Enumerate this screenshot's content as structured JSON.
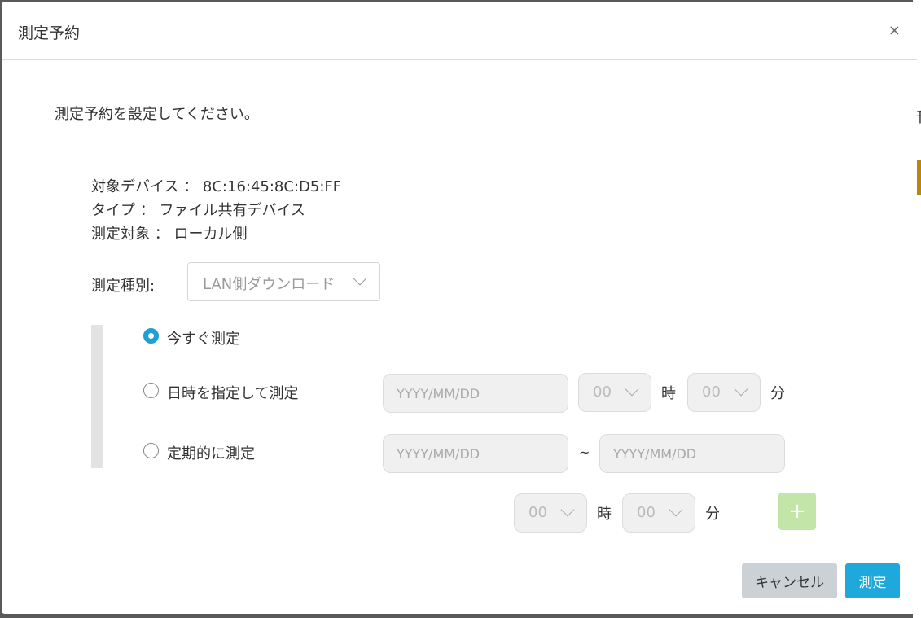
{
  "dialog": {
    "title": "測定予約",
    "close_icon": "×",
    "instruction": "測定予約を設定してください。"
  },
  "device_info": {
    "target_device": "対象デバイス ： 8C:16:45:8C:D5:FF",
    "type": "タイプ ： ファイル共有デバイス",
    "measure_target": "測定対象 ： ローカル側"
  },
  "measurement_type": {
    "label": "測定種別:",
    "selected": "LAN側ダウンロード"
  },
  "options": {
    "now": {
      "label": "今すぐ測定",
      "checked": true
    },
    "datetime": {
      "label": "日時を指定して測定",
      "checked": false,
      "date_placeholder": "YYYY/MM/DD",
      "hour": "00",
      "hour_unit": "時",
      "minute": "00",
      "minute_unit": "分"
    },
    "periodic": {
      "label": "定期的に測定",
      "checked": false,
      "start_placeholder": "YYYY/MM/DD",
      "separator": "~",
      "end_placeholder": "YYYY/MM/DD",
      "hour": "00",
      "hour_unit": "時",
      "minute": "00",
      "minute_unit": "分",
      "add_icon": "+"
    }
  },
  "footer": {
    "cancel_label": "キャンセル",
    "submit_label": "測定"
  },
  "colors": {
    "accent": "#1ea8dc",
    "add_button": "#c3e6a8",
    "cancel_button": "#ccd1d6"
  }
}
